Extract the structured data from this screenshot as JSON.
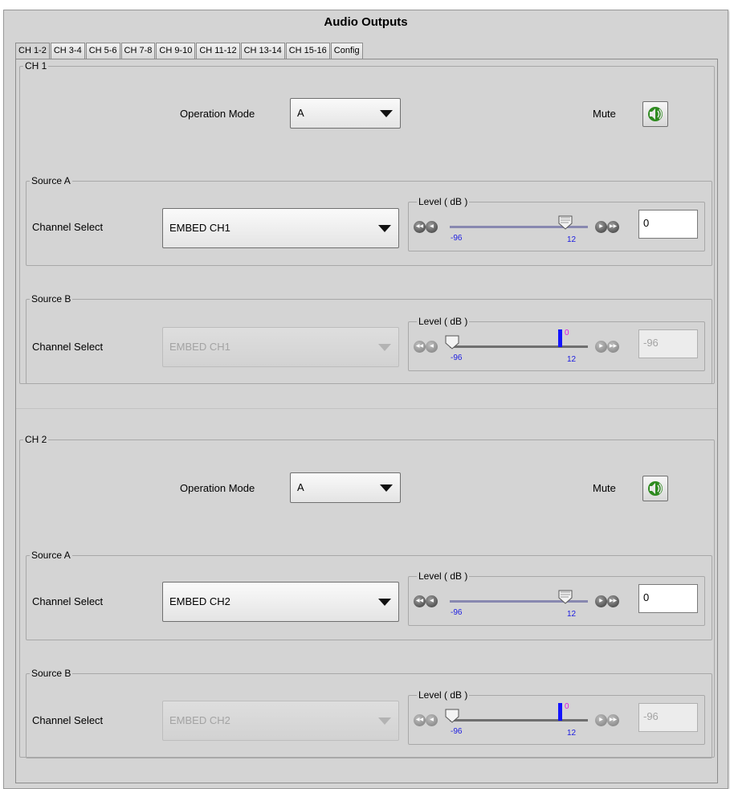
{
  "title": "Audio Outputs",
  "tabs": [
    "CH 1-2",
    "CH 3-4",
    "CH 5-6",
    "CH 7-8",
    "CH 9-10",
    "CH 11-12",
    "CH 13-14",
    "CH 15-16",
    "Config"
  ],
  "active_tab": "CH 1-2",
  "channels": [
    {
      "legend": "CH 1",
      "operation_mode_label": "Operation Mode",
      "operation_mode_value": "A",
      "mute_label": "Mute",
      "source_a": {
        "legend": "Source A",
        "channel_select_label": "Channel Select",
        "channel_select_value": "EMBED CH1",
        "level_legend": "Level ( dB )",
        "level_min": "-96",
        "level_max": "12",
        "level_value": "0",
        "enabled": true
      },
      "source_b": {
        "legend": "Source B",
        "channel_select_label": "Channel Select",
        "channel_select_value": "EMBED CH1",
        "level_legend": "Level ( dB )",
        "level_min": "-96",
        "level_max": "12",
        "level_marker": "0",
        "level_value": "-96",
        "enabled": false
      }
    },
    {
      "legend": "CH 2",
      "operation_mode_label": "Operation Mode",
      "operation_mode_value": "A",
      "mute_label": "Mute",
      "source_a": {
        "legend": "Source A",
        "channel_select_label": "Channel Select",
        "channel_select_value": "EMBED CH2",
        "level_legend": "Level ( dB )",
        "level_min": "-96",
        "level_max": "12",
        "level_value": "0",
        "enabled": true
      },
      "source_b": {
        "legend": "Source B",
        "channel_select_label": "Channel Select",
        "channel_select_value": "EMBED CH2",
        "level_legend": "Level ( dB )",
        "level_min": "-96",
        "level_max": "12",
        "level_marker": "0",
        "level_value": "-96",
        "enabled": false
      }
    }
  ],
  "colors": {
    "background": "#d4d4d4",
    "track_active": "#8888b0",
    "tick_text": "#1b1be0",
    "marker": "#1414ff",
    "marker_text": "#e011e0",
    "mute_icon": "#2e8a1f"
  }
}
